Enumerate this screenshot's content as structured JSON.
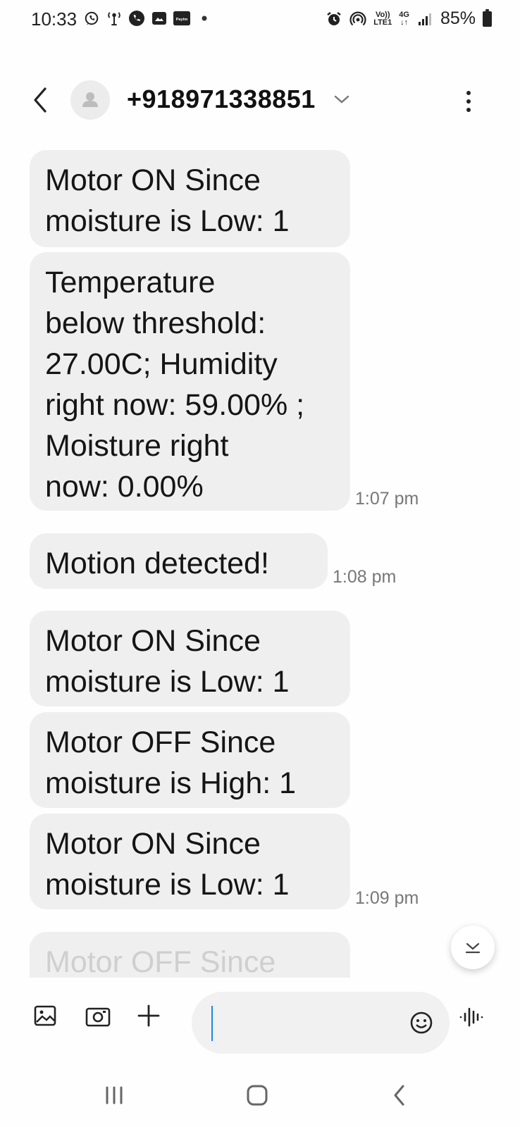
{
  "status_bar": {
    "time": "10:33",
    "left_icons": [
      "whatsapp-icon",
      "antenna-icon",
      "phone-icon",
      "gallery-icon",
      "paytm-icon",
      "dot-icon"
    ],
    "paytm_text": "Paytm",
    "network": {
      "line1": "Vo))",
      "line2": "LTE1",
      "tech": "4G"
    },
    "battery": "85%"
  },
  "header": {
    "contact": "+918971338851"
  },
  "messages": [
    {
      "text": "Motor ON Since\nmoisture is Low: 1",
      "time": ""
    },
    {
      "text": "Temperature\nbelow threshold:\n27.00C; Humidity\nright now: 59.00% ;\nMoisture right\nnow: 0.00%",
      "time": "1:07 pm"
    },
    {
      "text": "Motion detected!",
      "time": "1:08 pm"
    },
    {
      "text": "Motor ON Since\nmoisture is Low: 1",
      "time": ""
    },
    {
      "text": "Motor OFF Since\nmoisture is High: 1",
      "time": ""
    },
    {
      "text": "Motor ON Since\nmoisture is Low: 1",
      "time": "1:09 pm"
    },
    {
      "text": "Motor OFF Since\nmoisture",
      "time": ""
    }
  ],
  "composer": {
    "placeholder": "",
    "icons": [
      "gallery-icon",
      "camera-icon",
      "plus-icon",
      "emoji-icon",
      "voice-icon"
    ]
  },
  "colors": {
    "bubble": "#efefef",
    "accent": "#1e88e5"
  }
}
